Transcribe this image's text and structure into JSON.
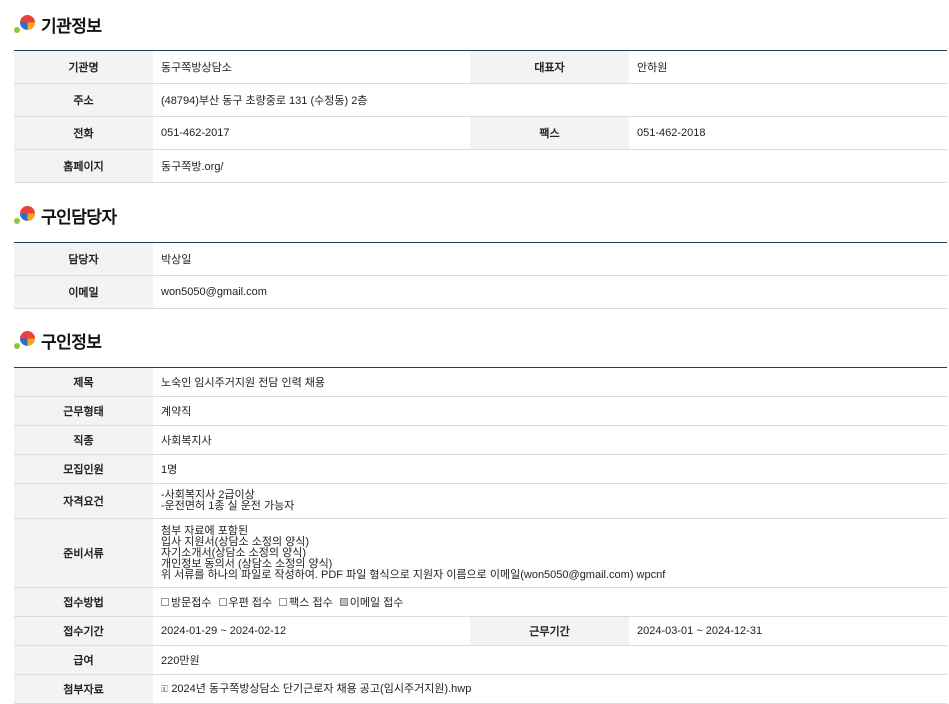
{
  "sections": {
    "org": {
      "title": "기관정보",
      "rows": {
        "name_label": "기관명",
        "name_value": "동구쪽방상담소",
        "rep_label": "대표자",
        "rep_value": "안하원",
        "addr_label": "주소",
        "addr_value": "(48794)부산 동구 초량중로 131 (수정동) 2층",
        "tel_label": "전화",
        "tel_value": "051-462-2017",
        "fax_label": "팩스",
        "fax_value": "051-462-2018",
        "home_label": "홈페이지",
        "home_value": "동구쪽방.org/"
      }
    },
    "contact": {
      "title": "구인담당자",
      "rows": {
        "person_label": "담당자",
        "person_value": "박상일",
        "email_label": "이메일",
        "email_value": "won5050@gmail.com"
      }
    },
    "job": {
      "title": "구인정보",
      "rows": {
        "subject_label": "제목",
        "subject_value": "노숙인 임시주거지원 전담 인력 채용",
        "type_label": "근무형태",
        "type_value": "계약직",
        "occupation_label": "직종",
        "occupation_value": "사회복지사",
        "count_label": "모집인원",
        "count_value": "1명",
        "qual_label": "자격요건",
        "qual_lines": [
          "-사회복지사 2급이상",
          "-운전면허 1종 실 운전 가능자"
        ],
        "docs_label": "준비서류",
        "docs_lines": [
          "첨부 자료에 포함된",
          "입사 지원서(상담소 소정의 양식)",
          "자기소개서(상담소 소정의 양식)",
          "개인정보 동의서 (상담소 소정의 양식)",
          "위 서류를 하나의 파일로 작성하여. PDF 파일 형식으로 지원자 이름으로 이메일(won5050@gmail.com) wpcnf"
        ],
        "method_label": "접수방법",
        "methods": [
          {
            "label": "방문접수",
            "checked": false
          },
          {
            "label": "우편 접수",
            "checked": false
          },
          {
            "label": "팩스 접수",
            "checked": false
          },
          {
            "label": "이메일 접수",
            "checked": true
          }
        ],
        "period_label": "접수기간",
        "period_value": "2024-01-29 ~ 2024-02-12",
        "work_period_label": "근무기간",
        "work_period_value": "2024-03-01 ~ 2024-12-31",
        "salary_label": "급여",
        "salary_value": "220만원",
        "attach_label": "첨부자료",
        "attach_value": "2024년 동구쪽방상담소 단기근로자 채용 공고(임시주거지원).hwp"
      }
    }
  }
}
